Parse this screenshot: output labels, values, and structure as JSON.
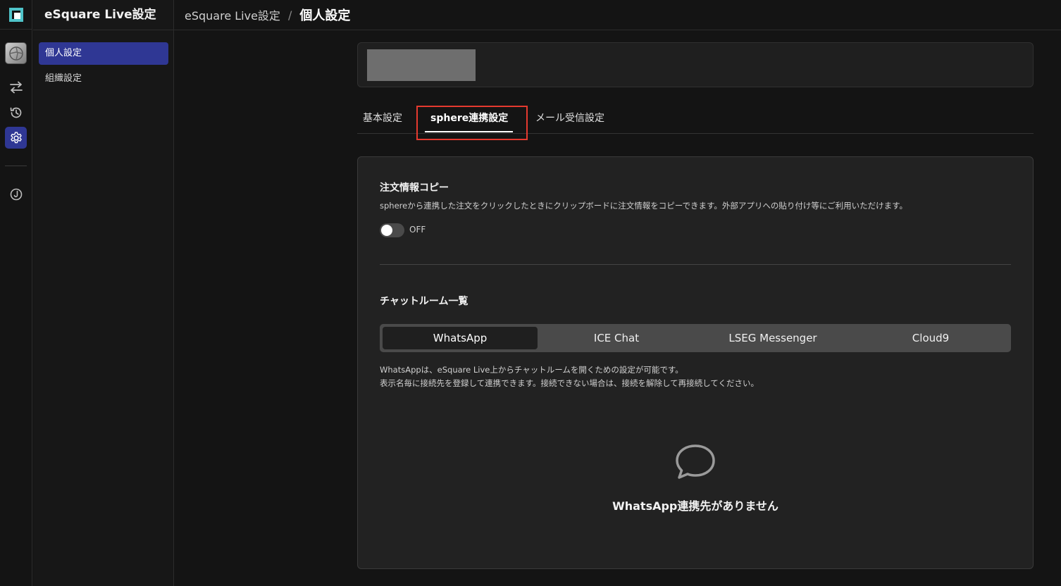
{
  "app": {
    "sidebar_title": "eSquare Live設定"
  },
  "breadcrumb": {
    "parent": "eSquare Live設定",
    "separator": "/",
    "current": "個人設定"
  },
  "sidebar": {
    "items": [
      {
        "label": "個人設定",
        "active": true
      },
      {
        "label": "組織設定",
        "active": false
      }
    ]
  },
  "rail": {
    "icons": [
      "avatar",
      "swap-icon",
      "history-icon",
      "gear-icon",
      "j-circle-icon"
    ],
    "active": "gear-icon"
  },
  "tabs": [
    {
      "label": "基本設定",
      "active": false
    },
    {
      "label": "sphere連携設定",
      "active": true
    },
    {
      "label": "メール受信設定",
      "active": false
    }
  ],
  "order_copy": {
    "title": "注文情報コピー",
    "description": "sphereから連携した注文をクリックしたときにクリップボードに注文情報をコピーできます。外部アプリへの貼り付け等にご利用いただけます。",
    "toggle_state": "OFF"
  },
  "chat_rooms": {
    "title": "チャットルーム一覧",
    "segments": [
      {
        "label": "WhatsApp",
        "active": true
      },
      {
        "label": "ICE Chat",
        "active": false
      },
      {
        "label": "LSEG Messenger",
        "active": false
      },
      {
        "label": "Cloud9",
        "active": false
      }
    ],
    "description_line1": "WhatsAppは、eSquare Live上からチャットルームを開くための設定が可能です。",
    "description_line2": "表示名毎に接続先を登録して連携できます。接続できない場合は、接続を解除して再接続してください。",
    "empty_icon": "chat-bubble-icon",
    "empty_message": "WhatsApp連携先がありません"
  },
  "colors": {
    "accent": "#2f3794",
    "highlight": "#e53a2f"
  }
}
